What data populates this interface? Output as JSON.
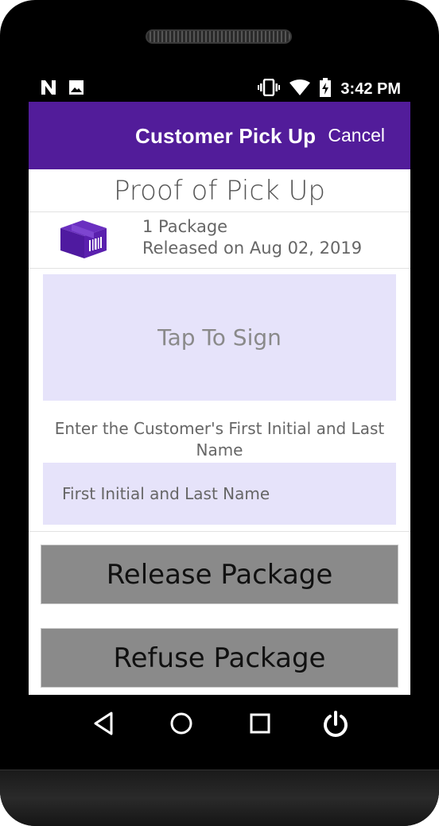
{
  "status_bar": {
    "time": "3:42 PM",
    "icons": [
      "n-notification-icon",
      "image-notification-icon",
      "vibrate-icon",
      "wifi-icon",
      "battery-charging-icon"
    ]
  },
  "app_bar": {
    "title": "Customer Pick Up",
    "cancel_label": "Cancel",
    "color": "#521c9a"
  },
  "proof": {
    "title": "Proof of Pick Up",
    "package_count": "1 Package",
    "released_text": "Released on Aug 02, 2019",
    "signature_prompt": "Tap To Sign",
    "name_label": "Enter the Customer's First Initial and Last Name",
    "name_value": "",
    "name_placeholder": "First Initial and Last Name"
  },
  "actions": {
    "release_label": "Release Package",
    "refuse_label": "Refuse Package"
  },
  "nav_bar": {
    "icons": [
      "back-icon",
      "home-icon",
      "recents-icon",
      "power-icon"
    ]
  }
}
